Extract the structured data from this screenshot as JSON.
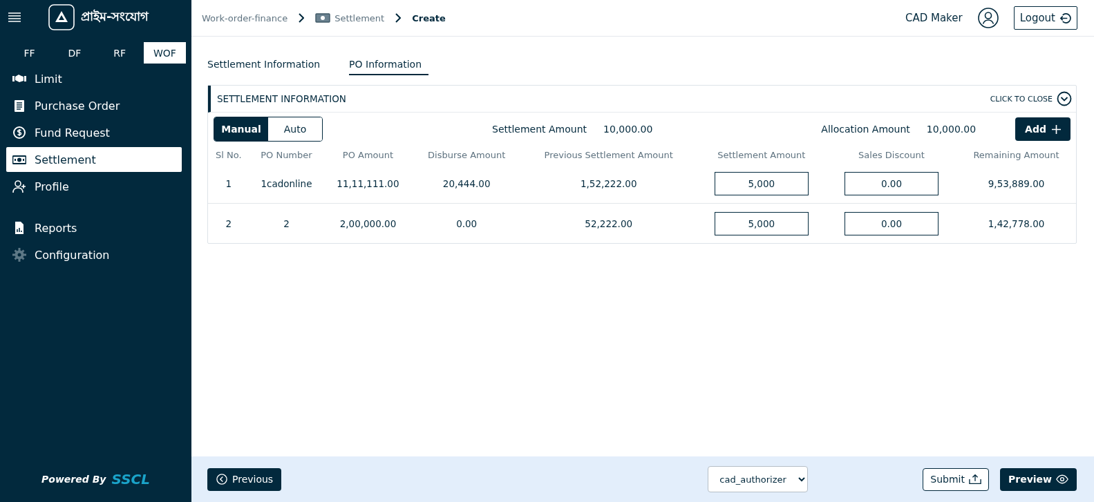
{
  "sidebar": {
    "brand": "প্রাইম-সংযোগ",
    "modules": [
      {
        "label": "FF",
        "selected": false
      },
      {
        "label": "DF",
        "selected": false
      },
      {
        "label": "RF",
        "selected": false
      },
      {
        "label": "WOF",
        "selected": true
      }
    ],
    "nav_items": [
      {
        "label": "Limit",
        "kind": "handshake",
        "selected": false
      },
      {
        "label": "Purchase Order",
        "kind": "document",
        "selected": false
      },
      {
        "label": "Fund Request",
        "kind": "dollar",
        "selected": false
      },
      {
        "label": "Settlement",
        "kind": "cash",
        "selected": true
      },
      {
        "label": "Profile",
        "kind": "userplus",
        "selected": false
      }
    ],
    "nav_items_2": [
      {
        "label": "Reports",
        "kind": "report",
        "selected": false
      },
      {
        "label": "Configuration",
        "kind": "gear",
        "selected": false
      }
    ],
    "powered_by": "Powered By",
    "powered_brand": "SSCL"
  },
  "breadcrumb": [
    "Work-order-finance",
    "Settlement",
    "Create"
  ],
  "user": {
    "name": "CAD Maker",
    "logout": "Logout"
  },
  "tabs": [
    {
      "label": "Settlement Information",
      "selected": false
    },
    {
      "label": "PO Information",
      "selected": true
    }
  ],
  "panel": {
    "title": "SETTLEMENT INFORMATION",
    "close_label": "CLICK TO CLOSE",
    "modes": [
      {
        "label": "Manual",
        "selected": true
      },
      {
        "label": "Auto",
        "selected": false
      }
    ],
    "settlement_amount_label": "Settlement Amount",
    "settlement_amount": "10,000.00",
    "allocation_amount_label": "Allocation Amount",
    "allocation_amount": "10,000.00",
    "add_button": "Add",
    "table": {
      "columns": [
        "Sl No.",
        "PO Number",
        "PO Amount",
        "Disburse Amount",
        "Previous Settlement Amount",
        "Settlement Amount",
        "Sales Discount",
        "Remaining Amount"
      ],
      "rows": [
        {
          "sl": "1",
          "po_number": "1cadonline",
          "po_amount": "11,11,111.00",
          "disburse": "20,444.00",
          "previous": "1,52,222.00",
          "settlement": "5,000",
          "discount": "0.00",
          "remaining": "9,53,889.00"
        },
        {
          "sl": "2",
          "po_number": "2",
          "po_amount": "2,00,000.00",
          "disburse": "0.00",
          "previous": "52,222.00",
          "settlement": "5,000",
          "discount": "0.00",
          "remaining": "1,42,778.00"
        }
      ]
    }
  },
  "footer": {
    "previous": "Previous",
    "role_select": "cad_authorizer",
    "submit": "Submit",
    "preview": "Preview"
  }
}
